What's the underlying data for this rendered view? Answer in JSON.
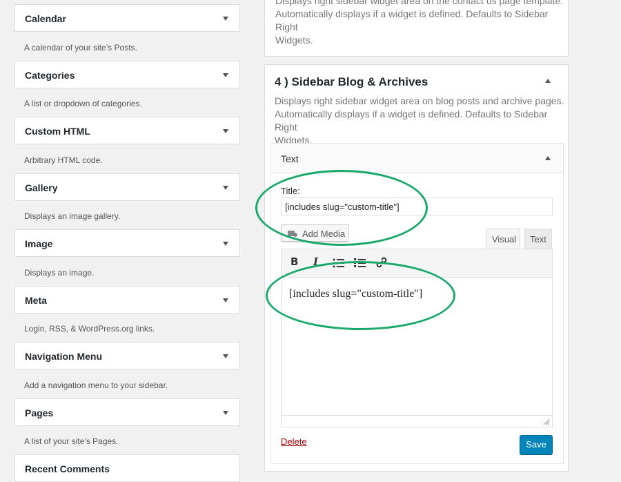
{
  "widgets": [
    {
      "title": "Calendar",
      "desc": "A calendar of your site’s Posts."
    },
    {
      "title": "Categories",
      "desc": "A list or dropdown of categories."
    },
    {
      "title": "Custom HTML",
      "desc": "Arbitrary HTML code."
    },
    {
      "title": "Gallery",
      "desc": "Displays an image gallery."
    },
    {
      "title": "Image",
      "desc": "Displays an image."
    },
    {
      "title": "Meta",
      "desc": "Login, RSS, & WordPress.org links."
    },
    {
      "title": "Navigation Menu",
      "desc": "Add a navigation menu to your sidebar."
    },
    {
      "title": "Pages",
      "desc": "A list of your site’s Pages."
    },
    {
      "title": "Recent Comments",
      "desc": ""
    }
  ],
  "top_panel": {
    "desc_line1": "Displays right sidebar widget area on the contact us page template.",
    "desc_line2": "Automatically displays if a widget is defined. Defaults to Sidebar Right",
    "desc_line3": "Widgets."
  },
  "sidebar": {
    "title": "4 ) Sidebar Blog & Archives",
    "desc_line1": "Displays right sidebar widget area on blog posts and archive pages.",
    "desc_line2": "Automatically displays if a widget is defined. Defaults to Sidebar Right",
    "desc_line3": "Widgets."
  },
  "text_widget": {
    "header": "Text",
    "title_label": "Title:",
    "title_value": "[includes slug=\"custom-title\"]",
    "add_media": "Add Media",
    "tab_visual": "Visual",
    "tab_text": "Text",
    "toolbar": {
      "bold": "B",
      "italic": "I"
    },
    "content": "[includes slug=\"custom-title\"]",
    "delete": "Delete",
    "save": "Save"
  },
  "colors": {
    "highlight": "#1aa96a",
    "primary": "#0085ba",
    "delete": "#a00"
  }
}
